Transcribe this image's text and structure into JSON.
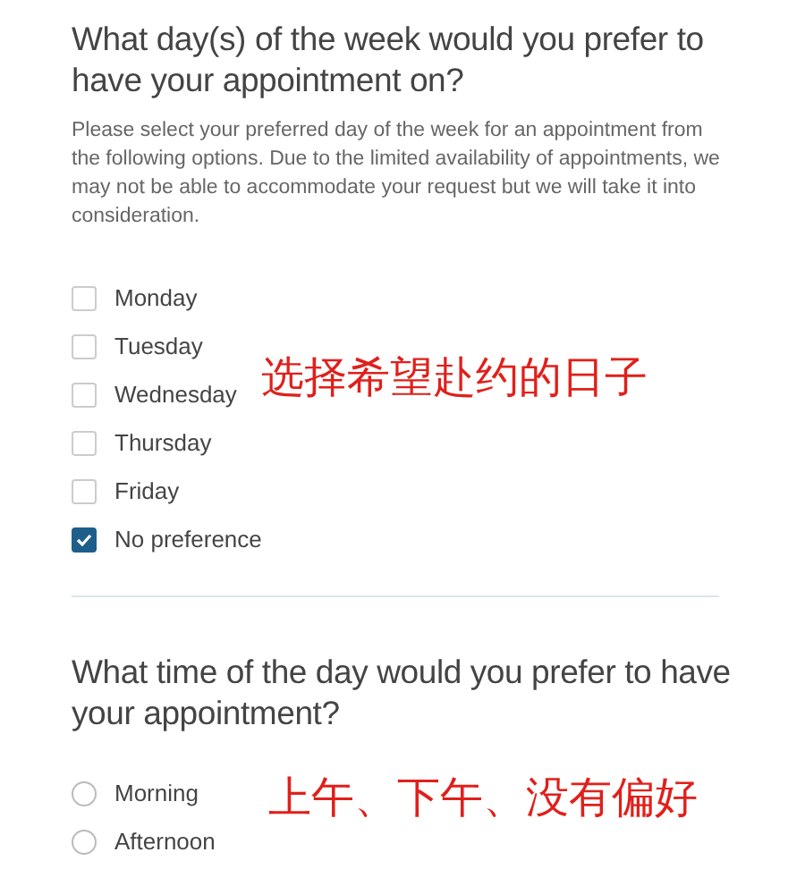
{
  "day_question": {
    "title": "What day(s) of the week would you prefer to have your appointment on?",
    "description": "Please select your preferred day of the week for an appointment from the following options. Due to the limited availability of appointments, we may not be able to accommodate your request but we will take it into consideration.",
    "options": [
      {
        "label": "Monday",
        "checked": false
      },
      {
        "label": "Tuesday",
        "checked": false
      },
      {
        "label": "Wednesday",
        "checked": false
      },
      {
        "label": "Thursday",
        "checked": false
      },
      {
        "label": "Friday",
        "checked": false
      },
      {
        "label": "No preference",
        "checked": true
      }
    ],
    "annotation": "选择希望赴约的日子"
  },
  "time_question": {
    "title": "What time of the day would you prefer to have your appointment?",
    "options": [
      {
        "label": "Morning",
        "selected": false
      },
      {
        "label": "Afternoon",
        "selected": false
      }
    ],
    "annotation": "上午、下午、没有偏好"
  }
}
